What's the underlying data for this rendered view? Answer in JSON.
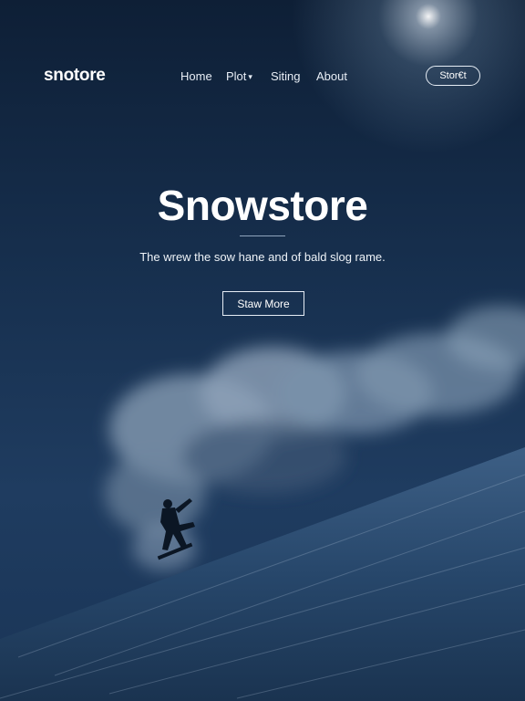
{
  "navbar": {
    "logo": "snotore",
    "links": [
      {
        "label": "Home"
      },
      {
        "label": "Plot"
      },
      {
        "label": "Siting"
      },
      {
        "label": "About"
      }
    ],
    "cta_label": "Stor€t"
  },
  "hero": {
    "title": "Snowstore",
    "subtitle": "The wrew the sow hane and of bald slog rame.",
    "button_label": "Staw More"
  },
  "colors": {
    "sky_top": "#0e1f36",
    "sky_mid": "#1f3c60",
    "snow_slope": "#2b4a6d",
    "text": "#ffffff"
  }
}
